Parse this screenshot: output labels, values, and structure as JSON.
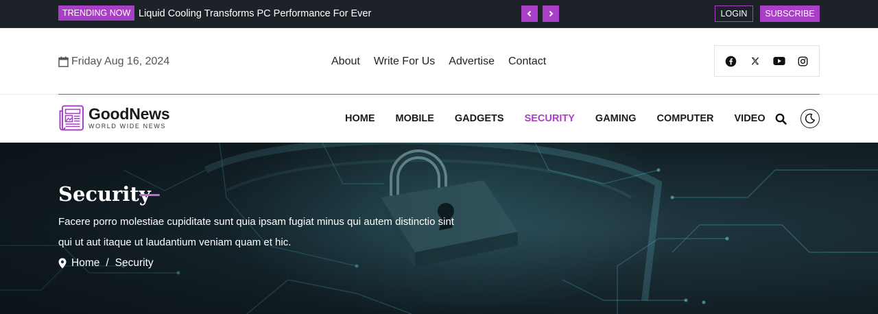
{
  "topbar": {
    "trending_label": "TRENDING NOW",
    "headline": "Liquid Cooling Transforms PC Performance For Ever",
    "login_label": "LOGIN",
    "subscribe_label": "SUBSCRIBE"
  },
  "header": {
    "date": "Friday Aug 16, 2024",
    "links": [
      "About",
      "Write For Us",
      "Advertise",
      "Contact"
    ],
    "social": [
      "facebook-icon",
      "x-icon",
      "youtube-icon",
      "instagram-icon"
    ]
  },
  "logo": {
    "title": "GoodNews",
    "subtitle": "WORLD WIDE NEWS"
  },
  "nav": {
    "items": [
      "HOME",
      "MOBILE",
      "GADGETS",
      "SECURITY",
      "GAMING",
      "COMPUTER",
      "VIDEO"
    ],
    "active": "SECURITY"
  },
  "hero": {
    "title": "Security",
    "description": "Facere porro molestiae cupiditate sunt quia ipsam fugiat minus qui autem distinctio sint qui ut aut itaque ut laudantium veniam quam et hic.",
    "breadcrumb": {
      "home": "Home",
      "separator": "/",
      "current": "Security"
    }
  },
  "colors": {
    "accent": "#a93fc6",
    "topbar_bg": "#1d2128",
    "hero_bg": "#1d333c"
  }
}
